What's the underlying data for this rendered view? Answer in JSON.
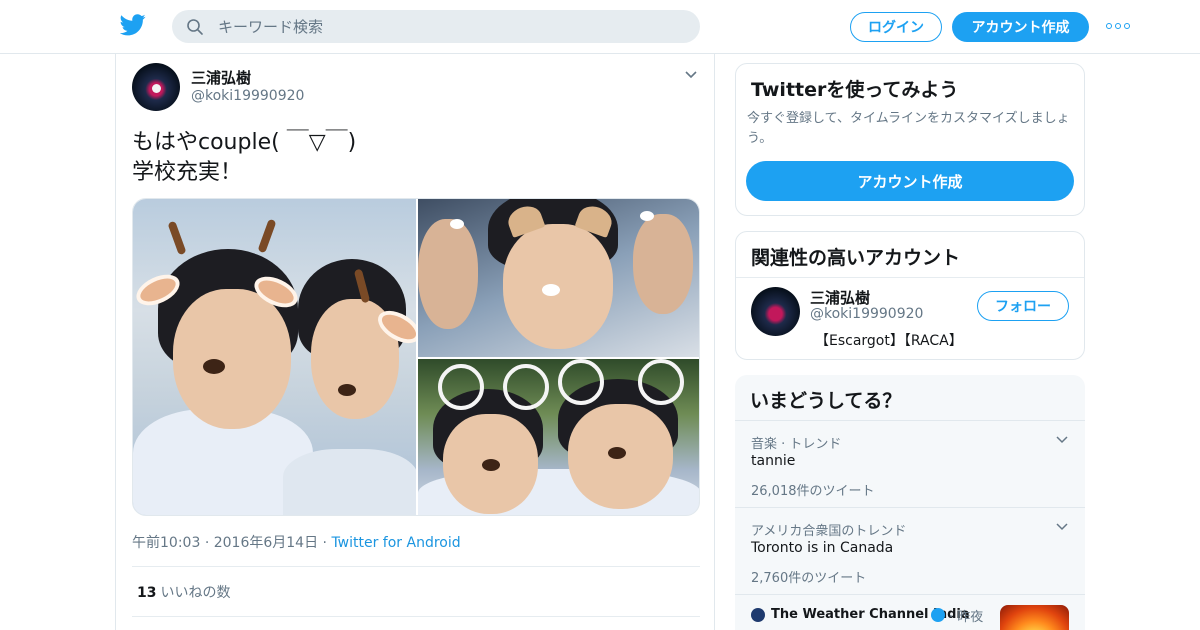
{
  "header": {
    "search_placeholder": "キーワード検索",
    "login_label": "ログイン",
    "signup_label": "アカウント作成"
  },
  "tweet": {
    "author_name": "三浦弘樹",
    "author_handle": "@koki19990920",
    "text": "もはやcouple( ￣▽￣)\n学校充実！",
    "time": "午前10:03",
    "date": "2016年6月14日",
    "source": "Twitter for Android",
    "like_count": "13",
    "like_label": "いいねの数"
  },
  "sidebar": {
    "signup_card": {
      "title": "Twitterを使ってみよう",
      "description": "今すぐ登録して、タイムラインをカスタマイズしましょう。",
      "button": "アカウント作成"
    },
    "related": {
      "title": "関連性の高いアカウント",
      "name": "三浦弘樹",
      "handle": "@koki19990920",
      "bio": "【Escargot】【RACA】",
      "follow_label": "フォロー"
    },
    "trends": {
      "title": "いまどうしてる？",
      "items": [
        {
          "context": "音楽 · トレンド",
          "name": "tannie",
          "count": "26,018件のツイート"
        },
        {
          "context": "アメリカ合衆国のトレンド",
          "name": "Toronto is in Canada",
          "count": "2,760件のツイート"
        }
      ],
      "promo": {
        "name": "The Weather Channel India",
        "time": "昨夜"
      }
    }
  },
  "colors": {
    "accent": "#1da1f2",
    "text": "#14171a",
    "muted": "#657786",
    "border": "#e1e8ed"
  }
}
